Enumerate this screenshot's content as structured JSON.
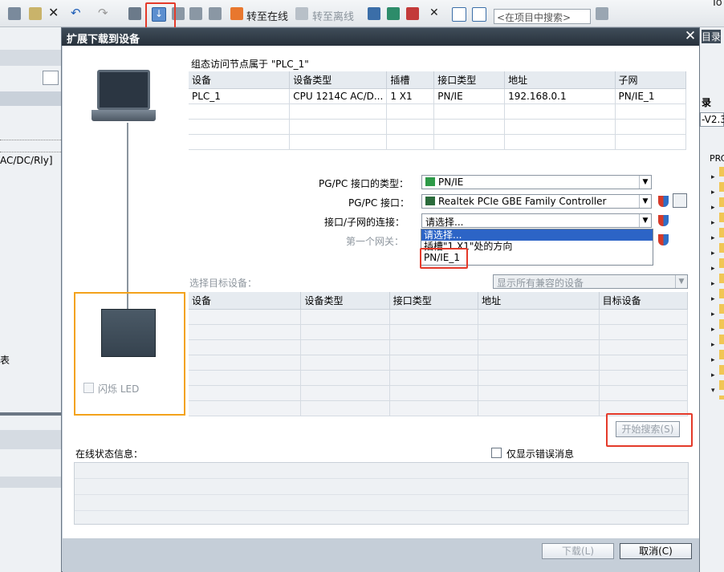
{
  "toolbar": {
    "go_online_label": "转至在线",
    "go_offline_label": "转至离线",
    "search_placeholder": "<在项目中搜索>",
    "right_edge_text": "To"
  },
  "left_pane": {
    "device_text": "AC/DC/Rly]",
    "table_text": "表"
  },
  "right_pane": {
    "catalog_fragment": "目录",
    "tree_head": "录",
    "version_fragment": "-V2.3",
    "prc_fragment": "PRC"
  },
  "dialog": {
    "title": "扩展下载到设备",
    "close_glyph": "✕",
    "config_caption": "组态访问节点属于 \"PLC_1\"",
    "config_table": {
      "headers": [
        "设备",
        "设备类型",
        "插槽",
        "接口类型",
        "地址",
        "子网"
      ],
      "rows": [
        [
          "PLC_1",
          "CPU 1214C AC/D...",
          "1 X1",
          "PN/IE",
          "192.168.0.1",
          "PN/IE_1"
        ]
      ]
    },
    "pgpc_type_label": "PG/PC 接口的类型：",
    "pgpc_type_value": "PN/IE",
    "pgpc_iface_label": "PG/PC 接口：",
    "pgpc_iface_value": "Realtek PCIe GBE Family Controller",
    "subnet_label": "接口/子网的连接：",
    "subnet_value": "请选择...",
    "gateway_label": "第一个网关：",
    "dropdown_options": [
      "请选择...",
      "插槽\"1 X1\"处的方向",
      "PN/IE_1"
    ],
    "target_label": "选择目标设备：",
    "target_filter_value": "显示所有兼容的设备",
    "target_table": {
      "headers": [
        "设备",
        "设备类型",
        "接口类型",
        "地址",
        "目标设备"
      ]
    },
    "flash_led_label": "闪烁 LED",
    "start_search_label": "开始搜索(S)",
    "online_status_label": "在线状态信息：",
    "only_errors_label": "仅显示错误消息",
    "download_label": "下载(L)",
    "cancel_label": "取消(C)"
  },
  "colors": {
    "highlight_red": "#e43a2a",
    "highlight_orange": "#f3a21b",
    "selection_blue": "#2c64c6"
  }
}
